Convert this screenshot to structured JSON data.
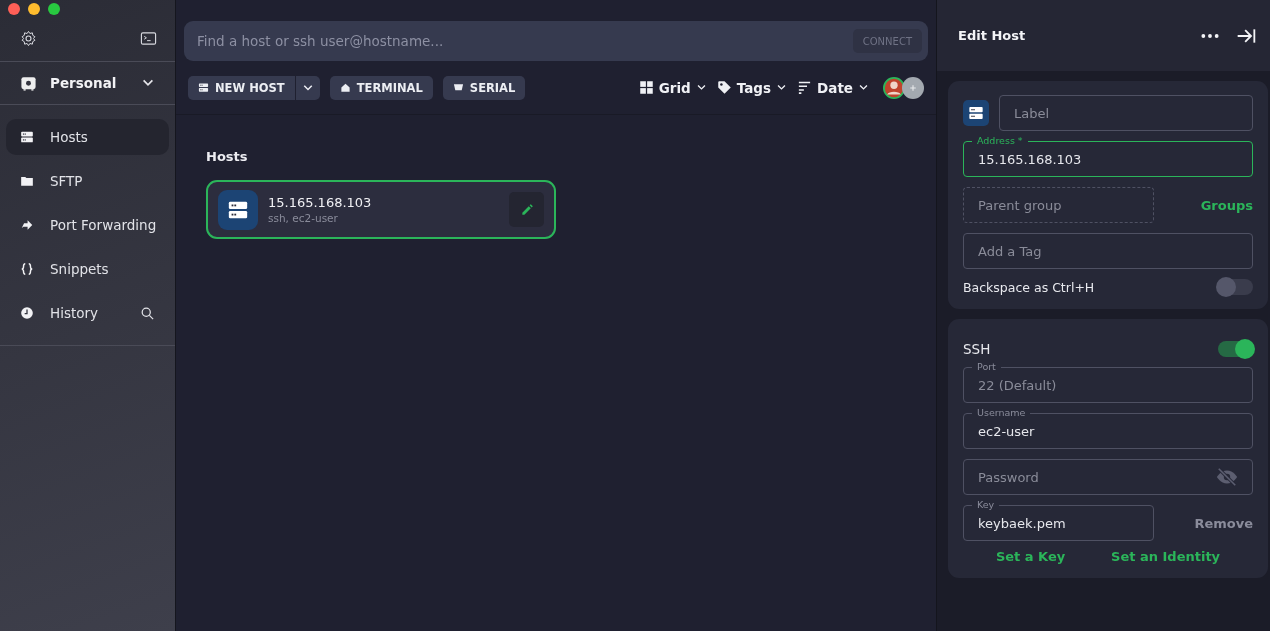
{
  "sidebar": {
    "workspace": {
      "label": "Personal",
      "expanded": false
    },
    "items": [
      {
        "label": "Hosts",
        "selected": true
      },
      {
        "label": "SFTP",
        "selected": false
      },
      {
        "label": "Port Forwarding",
        "selected": false
      },
      {
        "label": "Snippets",
        "selected": false
      },
      {
        "label": "History",
        "selected": false,
        "search": true
      }
    ]
  },
  "search": {
    "placeholder": "Find a host or ssh user@hostname...",
    "button": "CONNECT"
  },
  "toolbar": {
    "actions": [
      {
        "label": "NEW HOST",
        "dropdown": true
      },
      {
        "label": "TERMINAL",
        "dropdown": false
      },
      {
        "label": "SERIAL",
        "dropdown": false
      }
    ],
    "views": [
      {
        "label": "Grid"
      },
      {
        "label": "Tags"
      },
      {
        "label": "Date"
      }
    ]
  },
  "hosts_section": {
    "title": "Hosts",
    "hosts": [
      {
        "name": "15.165.168.103",
        "subtitle": "ssh, ec2-user",
        "selected": true
      }
    ]
  },
  "edit_panel": {
    "title": "Edit Host",
    "general": [
      {
        "kind": "label",
        "placeholder": "Label"
      },
      {
        "kind": "field",
        "label": "Address *",
        "value": "15.165.168.103",
        "focused": true
      },
      {
        "kind": "group",
        "placeholder": "Parent group",
        "link": "Groups"
      },
      {
        "kind": "field",
        "placeholder": "Add a Tag"
      },
      {
        "kind": "toggle",
        "label": "Backspace as Ctrl+H",
        "on": false
      }
    ],
    "ssh": [
      {
        "kind": "toggle",
        "label": "SSH",
        "on": true
      },
      {
        "kind": "field",
        "label": "Port",
        "placeholder": "22 (Default)"
      },
      {
        "kind": "field",
        "label": "Username",
        "value": "ec2-user"
      },
      {
        "kind": "password",
        "placeholder": "Password"
      },
      {
        "kind": "key",
        "label": "Key",
        "value": "keybaek.pem",
        "action": "Remove"
      },
      {
        "kind": "links",
        "links": [
          "Set a Key",
          "Set an Identity"
        ]
      }
    ]
  }
}
